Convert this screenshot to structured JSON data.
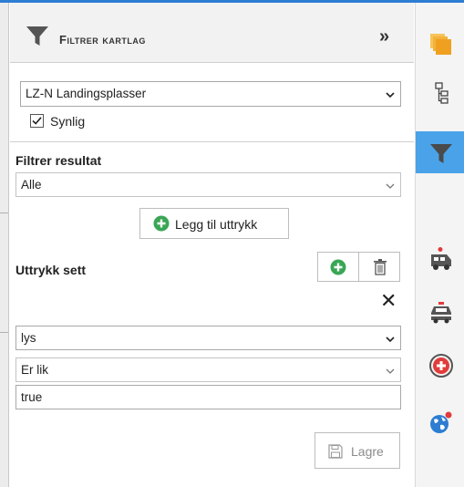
{
  "panel": {
    "header_title": "Filtrer kartlag",
    "layer_select_value": "LZ-N Landingsplasser",
    "visible_checkbox_label": "Synlig",
    "visible_checked": true,
    "filter_result_label": "Filtrer resultat",
    "filter_result_value": "Alle",
    "add_expression_label": "Legg til uttrykk",
    "expression_set_label": "Uttrykk sett",
    "expression": {
      "field_value": "lys",
      "operator_value": "Er lik",
      "value_input": "true"
    },
    "save_label": "Lagre"
  },
  "rightbar": {
    "items": [
      {
        "name": "layers-icon"
      },
      {
        "name": "tree-icon"
      },
      {
        "name": "filter-icon",
        "active": true
      },
      {
        "name": "ambulance-icon"
      },
      {
        "name": "police-car-icon"
      },
      {
        "name": "medical-cross-icon"
      },
      {
        "name": "globe-icon"
      }
    ]
  },
  "colors": {
    "accent": "#2d7dd2",
    "active_tab": "#4aa3e8",
    "add_green": "#3aa655",
    "layers_orange": "#f0a020",
    "medical_red": "#e23b3b"
  }
}
